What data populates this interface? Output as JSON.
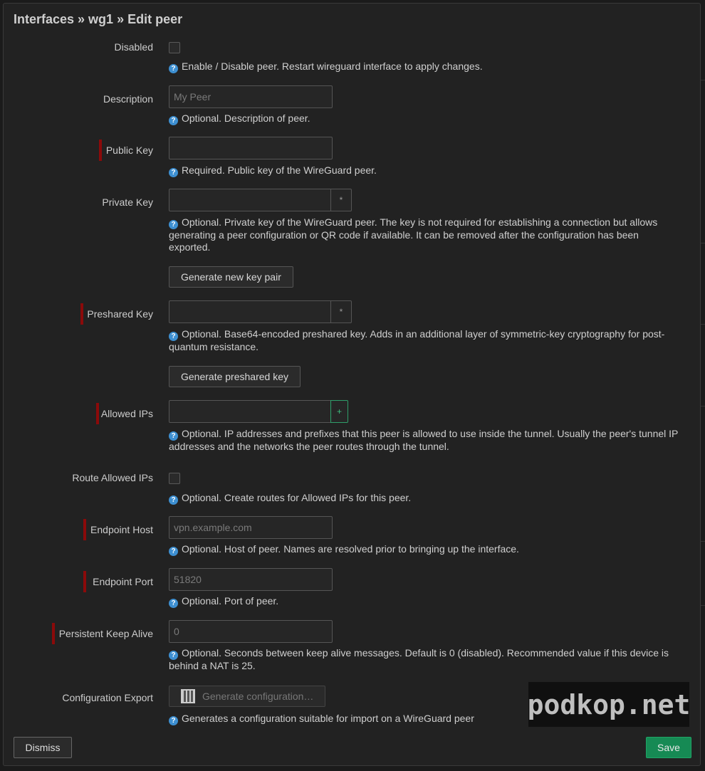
{
  "modal": {
    "title": "Interfaces » wg1 » Edit peer"
  },
  "fields": {
    "disabled": {
      "label": "Disabled",
      "help": "Enable / Disable peer. Restart wireguard interface to apply changes."
    },
    "description": {
      "label": "Description",
      "placeholder": "My Peer",
      "help": "Optional. Description of peer."
    },
    "public_key": {
      "label": "Public Key",
      "help": "Required. Public key of the WireGuard peer."
    },
    "private_key": {
      "label": "Private Key",
      "toggle": "*",
      "help": "Optional. Private key of the WireGuard peer. The key is not required for establishing a connection but allows generating a peer configuration or QR code if available. It can be removed after the configuration has been exported.",
      "button": "Generate new key pair"
    },
    "preshared_key": {
      "label": "Preshared Key",
      "toggle": "*",
      "help": "Optional. Base64-encoded preshared key. Adds in an additional layer of symmetric-key cryptography for post-quantum resistance.",
      "button": "Generate preshared key"
    },
    "allowed_ips": {
      "label": "Allowed IPs",
      "add": "+",
      "help": "Optional. IP addresses and prefixes that this peer is allowed to use inside the tunnel. Usually the peer's tunnel IP addresses and the networks the peer routes through the tunnel."
    },
    "route_allowed_ips": {
      "label": "Route Allowed IPs",
      "help": "Optional. Create routes for Allowed IPs for this peer."
    },
    "endpoint_host": {
      "label": "Endpoint Host",
      "placeholder": "vpn.example.com",
      "help": "Optional. Host of peer. Names are resolved prior to bringing up the interface."
    },
    "endpoint_port": {
      "label": "Endpoint Port",
      "placeholder": "51820",
      "help": "Optional. Port of peer."
    },
    "persistent_keepalive": {
      "label": "Persistent Keep Alive",
      "placeholder": "0",
      "help": "Optional. Seconds between keep alive messages. Default is 0 (disabled). Recommended value if this device is behind a NAT is 25."
    },
    "config_export": {
      "label": "Configuration Export",
      "button": "Generate configuration…",
      "help": "Generates a configuration suitable for import on a WireGuard peer"
    }
  },
  "footer": {
    "dismiss": "Dismiss",
    "save": "Save"
  },
  "watermark": "podkop.net",
  "colors": {
    "background": "#222222",
    "required_marker": "#8b0a0a",
    "help_icon": "#3d8fd1",
    "save_button": "#168a54"
  }
}
